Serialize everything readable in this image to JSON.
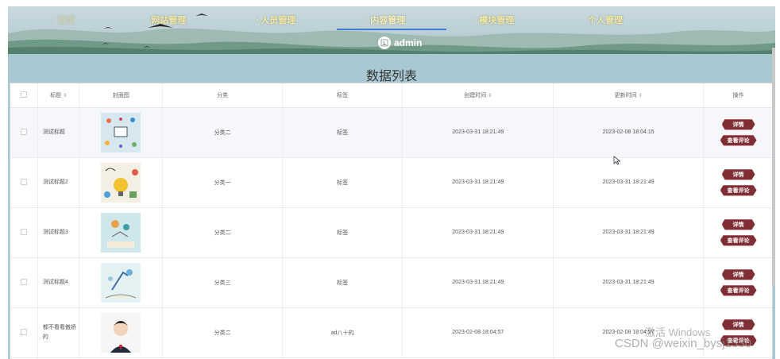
{
  "nav": {
    "items": [
      {
        "label": "首页",
        "icon": "home-icon"
      },
      {
        "label": "网站管理",
        "icon": "settings-icon"
      },
      {
        "label": "人员管理",
        "icon": "user-icon"
      },
      {
        "label": "内容管理",
        "icon": "content-icon"
      },
      {
        "label": "模块管理",
        "icon": "module-icon"
      },
      {
        "label": "个人管理",
        "icon": ""
      }
    ],
    "active": "内容管理"
  },
  "user": {
    "name": "admin"
  },
  "page_title": "数据列表",
  "table": {
    "columns": [
      "标题",
      "封面图",
      "分类",
      "标签",
      "创建时间",
      "更新时间",
      "操作"
    ],
    "rows": [
      {
        "title": "测试标题",
        "category": "分类二",
        "tag": "标签",
        "created": "2023-03-31 18:21:49",
        "updated": "2023-02-08 18:04:15"
      },
      {
        "title": "测试标题2",
        "category": "分类一",
        "tag": "标签",
        "created": "2023-03-31 18:21:49",
        "updated": "2023-03-31 18:21:49"
      },
      {
        "title": "测试标题3",
        "category": "分类二",
        "tag": "标签",
        "created": "2023-03-31 18:21:49",
        "updated": "2023-03-31 18:21:49"
      },
      {
        "title": "测试标题4",
        "category": "分类三",
        "tag": "标签",
        "created": "2023-03-31 18:21:49",
        "updated": "2023-03-31 18:21:49"
      },
      {
        "title": "都不看看傲娇的",
        "category": "分类二",
        "tag": "ad八十的",
        "created": "2023-02-08 18:04:57",
        "updated": "2023-02-08 18:04:57"
      }
    ],
    "actions": {
      "detail": "详情",
      "comments": "查看评论"
    }
  },
  "watermark": {
    "line1": "激活 Windows",
    "line2": "CSDN @weixin_bysj1330"
  },
  "colors": {
    "accent": "#7f2e35",
    "nav_text": "#f3e9a6",
    "active_underline": "#3d7fd6",
    "frame_bg": "#a9c9d2"
  }
}
